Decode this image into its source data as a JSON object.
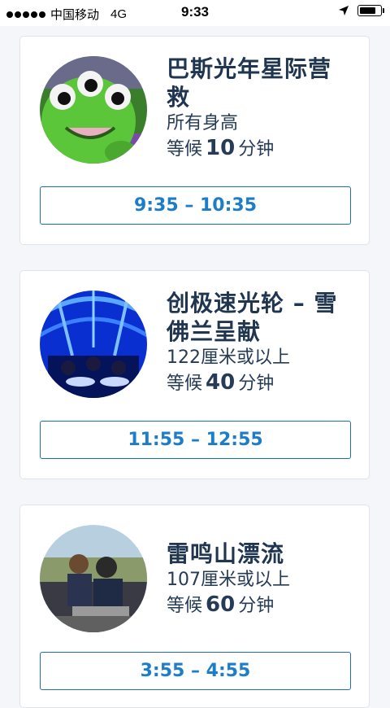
{
  "status_bar": {
    "carrier": "中国移动",
    "network": "4G",
    "time": "9:33",
    "battery_level": 0.85
  },
  "rides": [
    {
      "name": "巴斯光年星际营救",
      "height": "所有身高",
      "wait_prefix": "等候",
      "wait_value": "10",
      "wait_unit": "分钟",
      "return_time": "9:35 – 10:35",
      "image": "green-alien-character"
    },
    {
      "name": "创极速光轮 – 雪佛兰呈献",
      "height": "122厘米或以上",
      "wait_prefix": "等候",
      "wait_value": "40",
      "wait_unit": "分钟",
      "return_time": "11:55 – 12:55",
      "image": "blue-light-tunnel-riders"
    },
    {
      "name": "雷鸣山漂流",
      "height": "107厘米或以上",
      "wait_prefix": "等候",
      "wait_value": "60",
      "wait_unit": "分钟",
      "return_time": "3:55 – 4:55",
      "image": "raft-riders-photo"
    }
  ],
  "colors": {
    "accent": "#1c7dc8",
    "title": "#1f3550",
    "background": "#f4f6f9"
  }
}
